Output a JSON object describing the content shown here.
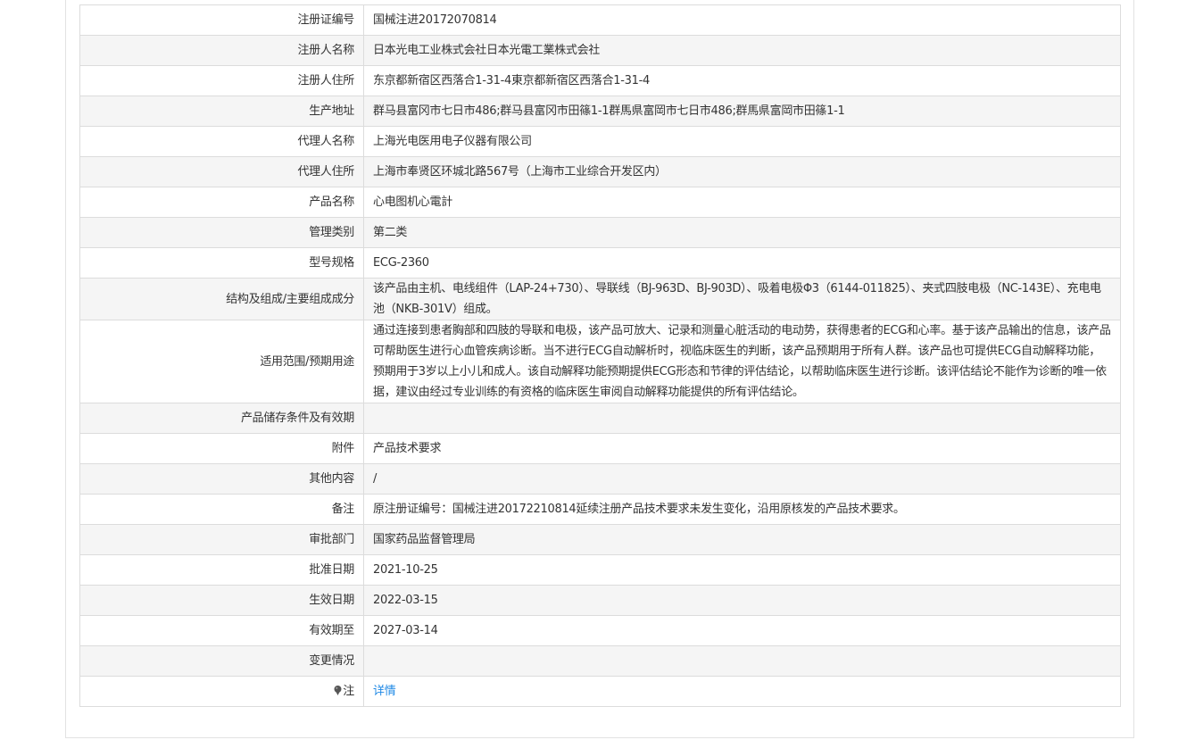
{
  "rows": [
    {
      "label": "注册证编号",
      "value": "国械注进20172070814"
    },
    {
      "label": "注册人名称",
      "value": "日本光电工业株式会社日本光電工業株式会社"
    },
    {
      "label": "注册人住所",
      "value": "东京都新宿区西落合1-31-4東京都新宿区西落合1-31-4"
    },
    {
      "label": "生产地址",
      "value": "群马县富冈市七日市486;群马县富冈市田篠1-1群馬県富岡市七日市486;群馬県富岡市田篠1-1"
    },
    {
      "label": "代理人名称",
      "value": "上海光电医用电子仪器有限公司"
    },
    {
      "label": "代理人住所",
      "value": "上海市奉贤区环城北路567号（上海市工业综合开发区内）"
    },
    {
      "label": "产品名称",
      "value": "心电图机心電計"
    },
    {
      "label": "管理类别",
      "value": "第二类"
    },
    {
      "label": "型号规格",
      "value": "ECG-2360"
    },
    {
      "label": "结构及组成/主要组成成分",
      "value": "该产品由主机、电线组件（LAP-24+730）、导联线（BJ-963D、BJ-903D）、吸着电极Φ3（6144-011825）、夹式四肢电极（NC-143E）、充电电池（NKB-301V）组成。"
    },
    {
      "label": "适用范围/预期用途",
      "value": "通过连接到患者胸部和四肢的导联和电极，该产品可放大、记录和测量心脏活动的电动势，获得患者的ECG和心率。基于该产品输出的信息，该产品可帮助医生进行心血管疾病诊断。当不进行ECG自动解析时，视临床医生的判断，该产品预期用于所有人群。该产品也可提供ECG自动解释功能，预期用于3岁以上小儿和成人。该自动解释功能预期提供ECG形态和节律的评估结论，以帮助临床医生进行诊断。该评估结论不能作为诊断的唯一依据，建议由经过专业训练的有资格的临床医生审阅自动解释功能提供的所有评估结论。"
    },
    {
      "label": "产品储存条件及有效期",
      "value": ""
    },
    {
      "label": "附件",
      "value": "产品技术要求"
    },
    {
      "label": "其他内容",
      "value": "/"
    },
    {
      "label": "备注",
      "value": "原注册证编号：国械注进20172210814延续注册产品技术要求未发生变化，沿用原核发的产品技术要求。"
    },
    {
      "label": "审批部门",
      "value": "国家药品监督管理局"
    },
    {
      "label": "批准日期",
      "value": "2021-10-25"
    },
    {
      "label": "生效日期",
      "value": "2022-03-15"
    },
    {
      "label": "有效期至",
      "value": "2027-03-14"
    },
    {
      "label": "变更情况",
      "value": ""
    }
  ],
  "note_row": {
    "icon": "pin-icon",
    "label": "注",
    "link_text": "详情",
    "link_color": "#1e88e5"
  }
}
